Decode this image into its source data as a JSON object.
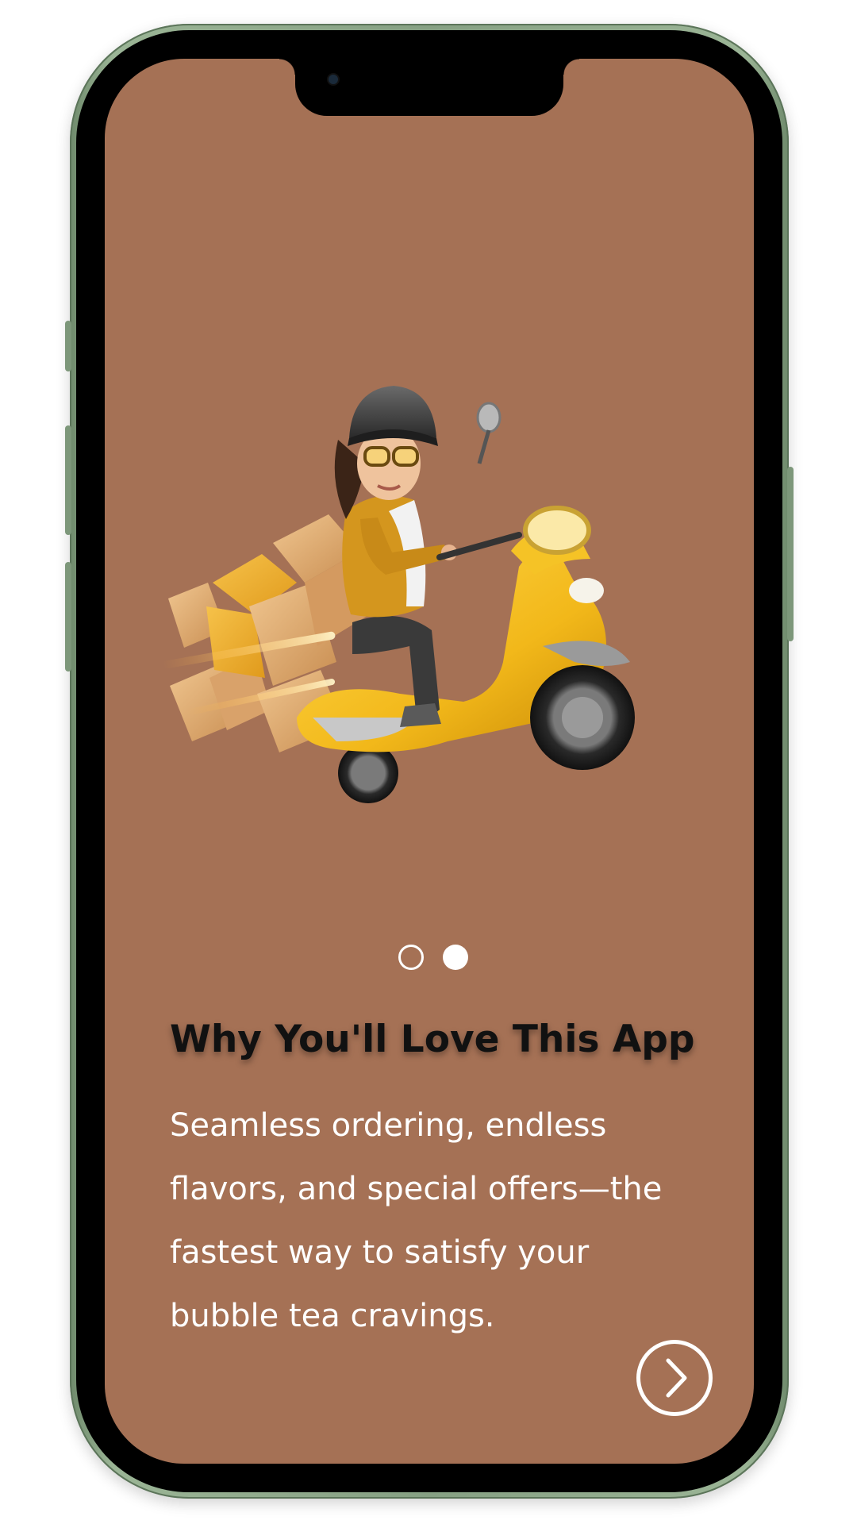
{
  "onboarding": {
    "title": "Why You'll Love This App",
    "description": "Seamless ordering, endless flavors, and special offers—the fastest way to satisfy your bubble tea cravings.",
    "pager": {
      "total": 2,
      "current": 2
    },
    "next_icon": "chevron-right-circle-icon",
    "illustration": "delivery-scooter-illustration"
  },
  "colors": {
    "background": "#a57155",
    "title": "#111111",
    "text": "#ffffff",
    "frame": "#86a083"
  }
}
